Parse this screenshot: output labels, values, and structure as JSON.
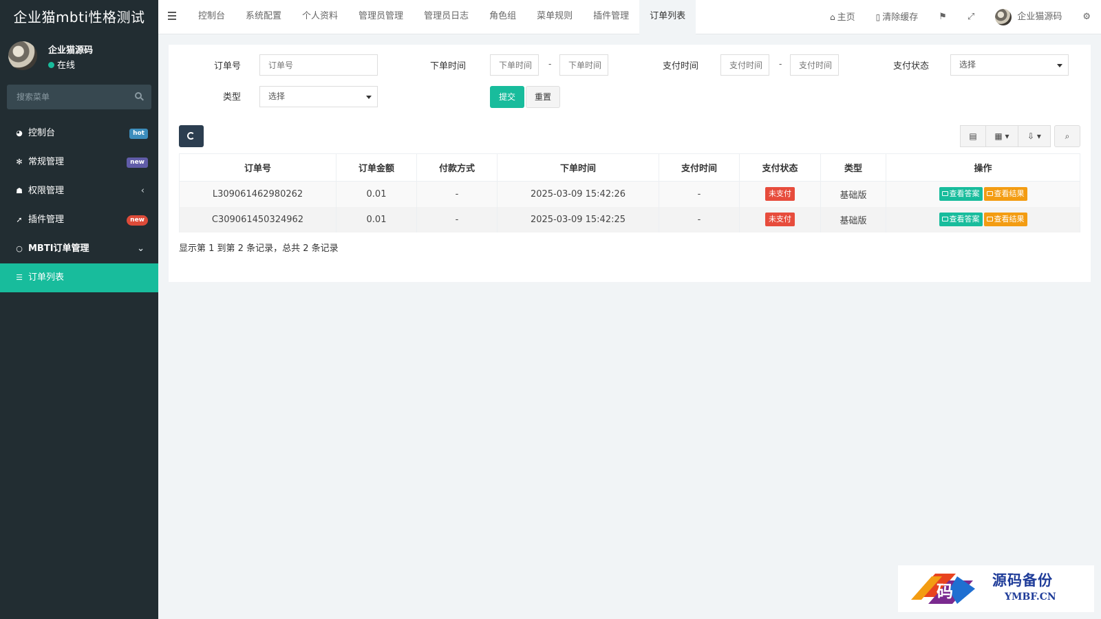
{
  "sidebar": {
    "brand": "企业猫mbti性格测试",
    "user": {
      "name": "企业猫源码",
      "status": "在线"
    },
    "search_placeholder": "搜索菜单",
    "items": [
      {
        "label": "控制台",
        "icon": "dashboard-icon",
        "badge": "hot"
      },
      {
        "label": "常规管理",
        "icon": "cogs-icon",
        "badge": "new"
      },
      {
        "label": "权限管理",
        "icon": "users-icon",
        "arrow": "‹"
      },
      {
        "label": "插件管理",
        "icon": "rocket-icon",
        "badge": "new"
      },
      {
        "label": "MBTI订单管理",
        "icon": "circle-icon",
        "arrow": "⌄"
      },
      {
        "label": "订单列表",
        "icon": "list-icon"
      }
    ]
  },
  "navbar": {
    "tabs": [
      "控制台",
      "系统配置",
      "个人资料",
      "管理员管理",
      "管理员日志",
      "角色组",
      "菜单规则",
      "插件管理",
      "订单列表"
    ],
    "active_tab": "订单列表",
    "right": {
      "home": "主页",
      "clear_cache": "清除缓存",
      "username": "企业猫源码"
    }
  },
  "filters": {
    "order_no": {
      "label": "订单号",
      "placeholder": "订单号"
    },
    "order_time": {
      "label": "下单时间",
      "from_placeholder": "下单时间",
      "to_placeholder": "下单时间",
      "separator": "-"
    },
    "pay_time": {
      "label": "支付时间",
      "from_placeholder": "支付时间",
      "to_placeholder": "支付时间",
      "separator": "-"
    },
    "pay_status": {
      "label": "支付状态",
      "value": "选择"
    },
    "type": {
      "label": "类型",
      "value": "选择"
    },
    "submit_label": "提交",
    "reset_label": "重置"
  },
  "table": {
    "columns": [
      "订单号",
      "订单金额",
      "付款方式",
      "下单时间",
      "支付时间",
      "支付状态",
      "类型",
      "操作"
    ],
    "rows": [
      {
        "order_no": "L309061462980262",
        "amount": "0.01",
        "pay_method": "-",
        "order_time": "2025-03-09 15:42:26",
        "pay_time": "-",
        "status": "未支付",
        "type": "基础版",
        "op_answer": "查看答案",
        "op_result": "查看结果"
      },
      {
        "order_no": "C309061450324962",
        "amount": "0.01",
        "pay_method": "-",
        "order_time": "2025-03-09 15:42:25",
        "pay_time": "-",
        "status": "未支付",
        "type": "基础版",
        "op_answer": "查看答案",
        "op_result": "查看结果"
      }
    ],
    "pager_text": "显示第 1 到第 2 条记录，总共 2 条记录"
  },
  "watermark": {
    "cn": "源码备份",
    "en": "YMBF.CN",
    "logo_char": "码"
  },
  "colors": {
    "sidebar_bg": "#222d32",
    "accent": "#18bc9c",
    "danger": "#e74c3c",
    "warning": "#f39c12",
    "dark_button": "#2c3e50"
  }
}
